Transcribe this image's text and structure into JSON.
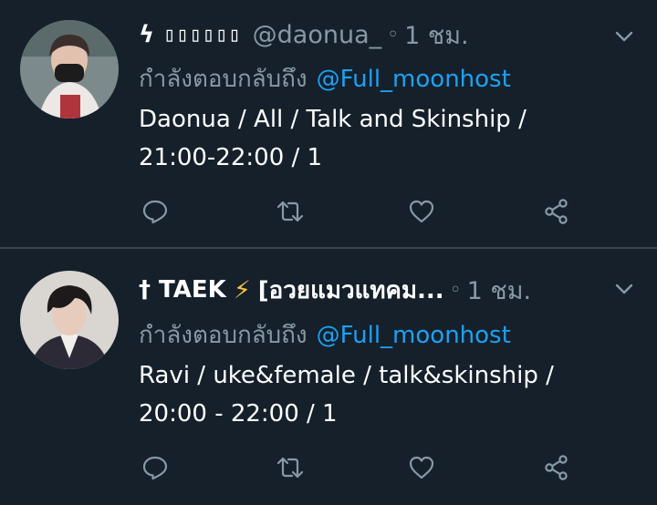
{
  "tweets": [
    {
      "display_name": "ϟ",
      "name_boxes": "▯▯▯▯▯▯",
      "handle": "@daonua_",
      "dot": "◦",
      "time": "1 ชม.",
      "reply_label": "กำลังตอบกลับถึง",
      "reply_mention": "@Full_moonhost",
      "body_lines": [
        "Daonua / All / Talk and Skinship /",
        "21:00-22:00 / 1"
      ]
    },
    {
      "display_name": "† TAEK",
      "name_emoji": "⚡",
      "name_suffix": "[อวยแมวแทคม...",
      "dot": "◦",
      "time": "1 ชม.",
      "reply_label": "กำลังตอบกลับถึง",
      "reply_mention": "@Full_moonhost",
      "body_lines": [
        "Ravi / uke&female / talk&skinship /",
        "20:00 - 22:00 / 1"
      ]
    }
  ],
  "icons": {
    "reply": "reply-icon",
    "retweet": "retweet-icon",
    "like": "heart-icon",
    "share": "share-icon",
    "caret": "chevron-down-icon"
  },
  "colors": {
    "background": "#15202b",
    "text": "#ffffff",
    "muted": "#8899a6",
    "link": "#1da1f2",
    "divider": "#38444d"
  }
}
